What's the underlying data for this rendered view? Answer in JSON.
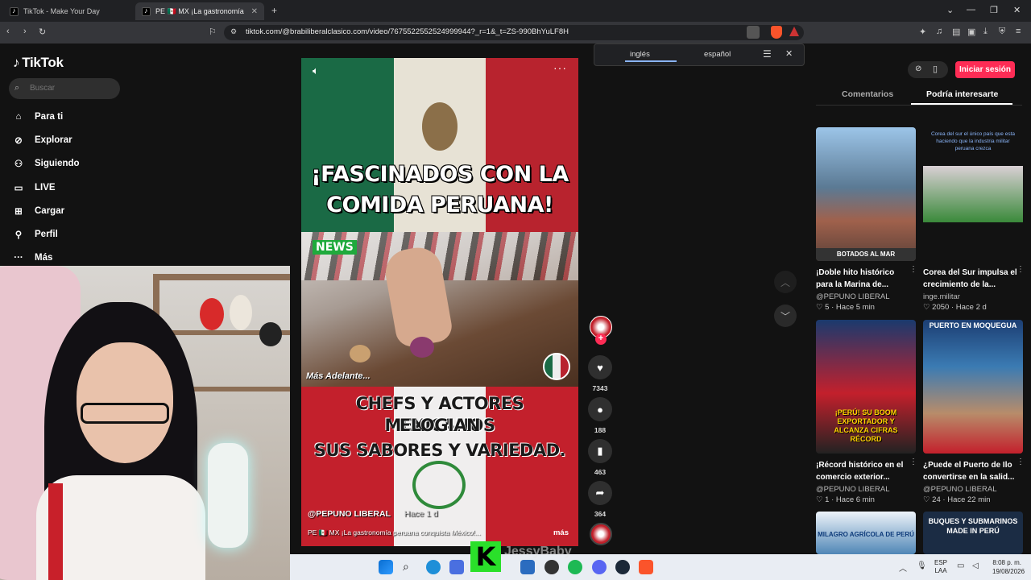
{
  "browser": {
    "tabs": [
      {
        "label": "TikTok - Make Your Day"
      },
      {
        "label": "PE 🇲🇽 MX ¡La gastronomía peru..."
      }
    ],
    "url": "tiktok.com/@brabiliberalclasico.com/video/7675522552524999944?_r=1&_t=ZS-990BhYuLF8H"
  },
  "sidebar": {
    "logo": "TikTok",
    "search_placeholder": "Buscar",
    "items": [
      {
        "label": "Para ti",
        "icon": "home-icon"
      },
      {
        "label": "Explorar",
        "icon": "compass-icon"
      },
      {
        "label": "Siguiendo",
        "icon": "following-icon"
      },
      {
        "label": "LIVE",
        "icon": "live-icon"
      },
      {
        "label": "Cargar",
        "icon": "upload-icon"
      },
      {
        "label": "Perfil",
        "icon": "profile-icon"
      },
      {
        "label": "Más",
        "icon": "more-icon"
      }
    ]
  },
  "translate": {
    "from": "inglés",
    "to": "español"
  },
  "video": {
    "headline_top": "¡FASCINADOS CON LA COMIDA PERUANA!",
    "news_tag": "NEWS",
    "mas_adelante": "Más Adelante...",
    "headline_bottom_1": "CHEFS Y ACTORES MEXICANOS",
    "headline_bottom_2": "ELOGIAN",
    "headline_bottom_3": "SUS SABORES Y VARIEDAD.",
    "author": "@PEPUNO LIBERAL",
    "time": "Hace 1 d",
    "caption": "PE 🇲🇽 MX ¡La gastronomía peruana conquista México!...",
    "more": "más"
  },
  "actions": {
    "likes": "7343",
    "comments": "188",
    "saves": "463",
    "shares": "364"
  },
  "right": {
    "login": "Iniciar sesión",
    "tab_comments": "Comentarios",
    "tab_interest": "Podría interesarte",
    "cards": [
      {
        "title": "¡Doble hito histórico para la Marina de...",
        "author": "@PEPUNO LIBERAL",
        "likes": "5",
        "time": "Hace 5 min",
        "thumb_text": "BOTADOS AL MAR"
      },
      {
        "title": "Corea del Sur impulsa el crecimiento de la...",
        "author": "inge.militar",
        "likes": "2050",
        "time": "Hace 2 d",
        "thumb_text": "Corea del sur el único país que esta haciendo que la industria militar peruana crezca"
      },
      {
        "title": "¡Récord histórico en el comercio exterior...",
        "author": "@PEPUNO LIBERAL",
        "likes": "1",
        "time": "Hace 6 min",
        "thumb_text": "¡PERÚ! SU BOOM EXPORTADOR Y ALCANZA CIFRAS RÉCORD"
      },
      {
        "title": "¿Puede el Puerto de Ilo convertirse en la salid...",
        "author": "@PEPUNO LIBERAL",
        "likes": "24",
        "time": "Hace 22 min",
        "thumb_text": "PUERTO EN MOQUEGUA"
      },
      {
        "thumb_text": "MILAGRO AGRÍCOLA DE PERÚ"
      },
      {
        "thumb_text": "BUQUES Y SUBMARINOS MADE IN PERÚ"
      }
    ]
  },
  "taskbar": {
    "lang": "ESP\nLAA",
    "time": "8:08 p. m.",
    "date": "19/08/2026"
  },
  "overlay": {
    "watermark": "JessyBaby",
    "k": "K"
  }
}
